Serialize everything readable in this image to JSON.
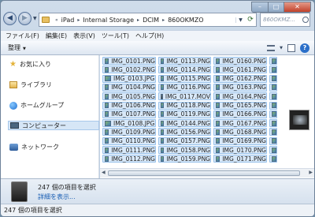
{
  "window": {
    "min_symbol": "–",
    "max_symbol": "□",
    "close_symbol": "✕"
  },
  "address": {
    "crumbs": [
      "iPad",
      "Internal Storage",
      "DCIM",
      "860OKMZO"
    ],
    "separator": "▸",
    "lead": "«"
  },
  "search": {
    "placeholder": "860OKMZ..."
  },
  "menu": [
    "ファイル(F)",
    "編集(E)",
    "表示(V)",
    "ツール(T)",
    "ヘルプ(H)"
  ],
  "toolbar": {
    "organize": "整理",
    "help": "?"
  },
  "nav": {
    "favorites": "お気に入り",
    "libraries": "ライブラリ",
    "homegroup": "ホームグループ",
    "computer": "コンピューター",
    "network": "ネットワーク"
  },
  "files": {
    "col1": [
      "IMG_0101.PNG",
      "IMG_0102.PNG",
      "IMG_0103.JPG",
      "IMG_0104.PNG",
      "IMG_0105.PNG",
      "IMG_0106.PNG",
      "IMG_0107.PNG",
      "IMG_0108.JPG",
      "IMG_0109.PNG",
      "IMG_0110.PNG",
      "IMG_0111.PNG",
      "IMG_0112.PNG"
    ],
    "col2": [
      "IMG_0113.PNG",
      "IMG_0114.PNG",
      "IMG_0115.PNG",
      "IMG_0116.PNG",
      "IMG_0117.MOV",
      "IMG_0118.PNG",
      "IMG_0119.PNG",
      "IMG_0144.PNG",
      "IMG_0156.PNG",
      "IMG_0157.PNG",
      "IMG_0158.PNG",
      "IMG_0159.PNG"
    ],
    "col3": [
      "IMG_0160.PNG",
      "IMG_0161.PNG",
      "IMG_0162.PNG",
      "IMG_0163.PNG",
      "IMG_0164.PNG",
      "IMG_0165.PNG",
      "IMG_0166.PNG",
      "IMG_0167.PNG",
      "IMG_0168.PNG",
      "IMG_0169.PNG",
      "IMG_0170.PNG",
      "IMG_0171.PNG"
    ]
  },
  "details": {
    "title": "247 個の項目を選択",
    "link": "詳細を表示..."
  },
  "status": "247 個の項目を選択"
}
